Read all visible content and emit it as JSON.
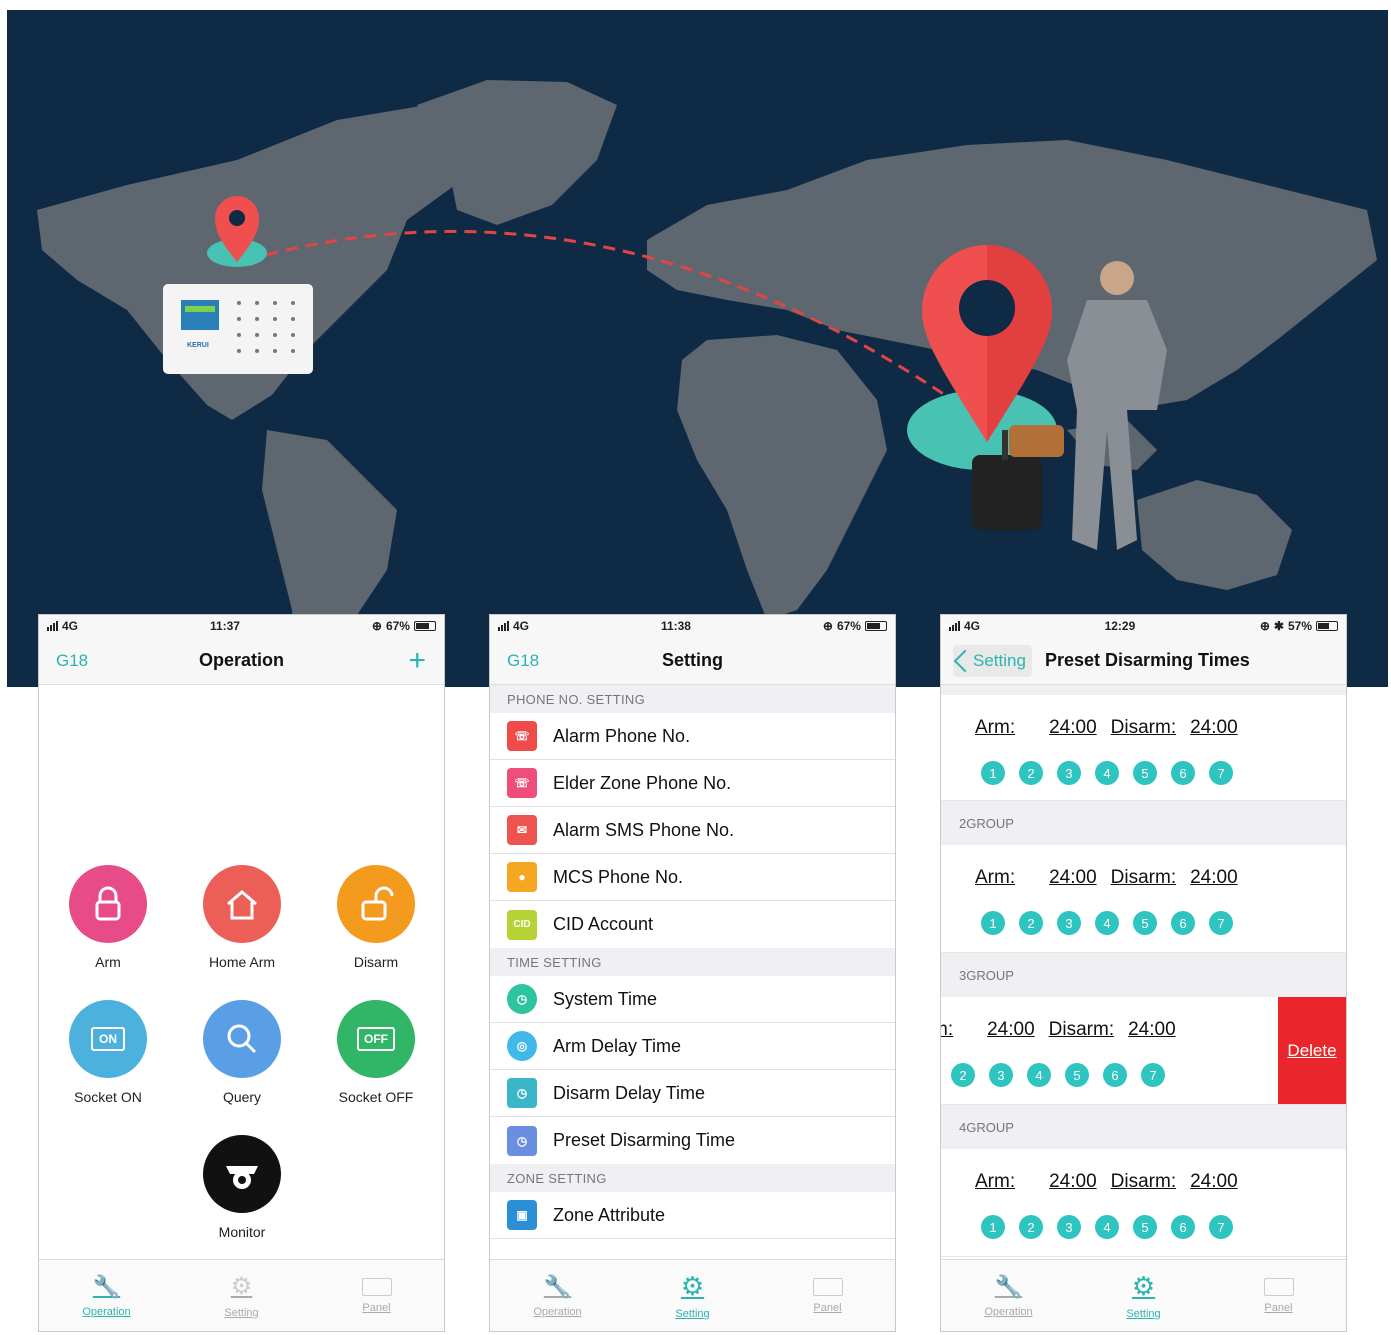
{
  "phone_operation": {
    "status": {
      "network": "4G",
      "time": "11:37",
      "battery": "67%"
    },
    "nav": {
      "left": "G18",
      "title": "Operation",
      "right": "+"
    },
    "buttons": [
      {
        "label": "Arm",
        "icon": "lock-icon",
        "color": "#e74c88"
      },
      {
        "label": "Home Arm",
        "icon": "home-icon",
        "color": "#ec5f57"
      },
      {
        "label": "Disarm",
        "icon": "unlock-icon",
        "color": "#f39a1f"
      },
      {
        "label": "Socket ON",
        "icon": "socket-on-icon",
        "color": "#4db1dd",
        "text": "ON"
      },
      {
        "label": "Query",
        "icon": "search-icon",
        "color": "#5a9ee6"
      },
      {
        "label": "Socket OFF",
        "icon": "socket-off-icon",
        "color": "#31b567",
        "text": "OFF"
      },
      {
        "label": "Monitor",
        "icon": "camera-icon",
        "color": "#111111"
      }
    ],
    "tabs": [
      {
        "label": "Operation",
        "active": true
      },
      {
        "label": "Setting",
        "active": false
      },
      {
        "label": "Panel",
        "active": false
      }
    ]
  },
  "phone_setting": {
    "status": {
      "network": "4G",
      "time": "11:38",
      "battery": "67%"
    },
    "nav": {
      "left": "G18",
      "title": "Setting"
    },
    "sections": [
      {
        "title": "PHONE NO. SETTING",
        "items": [
          {
            "label": "Alarm Phone No.",
            "color": "#ef4b4b"
          },
          {
            "label": "Elder Zone Phone No.",
            "color": "#f04e7a"
          },
          {
            "label": "Alarm SMS Phone No.",
            "color": "#ef5350"
          },
          {
            "label": "MCS Phone No.",
            "color": "#f5a623"
          },
          {
            "label": "CID Account",
            "color": "#b5d334",
            "text": "CID"
          }
        ]
      },
      {
        "title": "TIME SETTING",
        "items": [
          {
            "label": "System Time",
            "color": "#2ec4a0"
          },
          {
            "label": "Arm Delay Time",
            "color": "#40b9e8"
          },
          {
            "label": "Disarm Delay Time",
            "color": "#3ab6c8"
          },
          {
            "label": "Preset Disarming Time",
            "color": "#6a8fe0"
          }
        ]
      },
      {
        "title": "ZONE SETTING",
        "items": [
          {
            "label": "Zone Attribute",
            "color": "#2a8fd6"
          }
        ]
      }
    ],
    "tabs": [
      {
        "label": "Operation",
        "active": false
      },
      {
        "label": "Setting",
        "active": true
      },
      {
        "label": "Panel",
        "active": false
      }
    ]
  },
  "phone_preset": {
    "status": {
      "network": "4G",
      "time": "12:29",
      "battery": "57%"
    },
    "nav": {
      "back": "Setting",
      "title": "Preset Disarming Times"
    },
    "arm_label": "Arm:",
    "disarm_label": "Disarm:",
    "groups": [
      {
        "title": "",
        "arm": "24:00",
        "disarm": "24:00",
        "swiped": false
      },
      {
        "title": "2GROUP",
        "arm": "24:00",
        "disarm": "24:00",
        "swiped": false
      },
      {
        "title": "3GROUP",
        "arm": "24:00",
        "disarm": "24:00",
        "swiped": true
      },
      {
        "title": "4GROUP",
        "arm": "24:00",
        "disarm": "24:00",
        "swiped": false
      }
    ],
    "days": [
      "1",
      "2",
      "3",
      "4",
      "5",
      "6",
      "7"
    ],
    "delete_label": "Delete",
    "tabs": [
      {
        "label": "Operation",
        "active": false
      },
      {
        "label": "Setting",
        "active": true
      },
      {
        "label": "Panel",
        "active": false
      }
    ]
  },
  "hero": {
    "panel_brand": "KERUI",
    "colors": {
      "ocean": "#0f2a44",
      "land": "#5e6670",
      "pin": "#ef4f4f",
      "pin_base": "#48c2b3",
      "route": "#e24545"
    }
  },
  "colors": {
    "accent": "#2bb5b0",
    "delete": "#e8262b",
    "day_dot": "#2ec4bf"
  }
}
